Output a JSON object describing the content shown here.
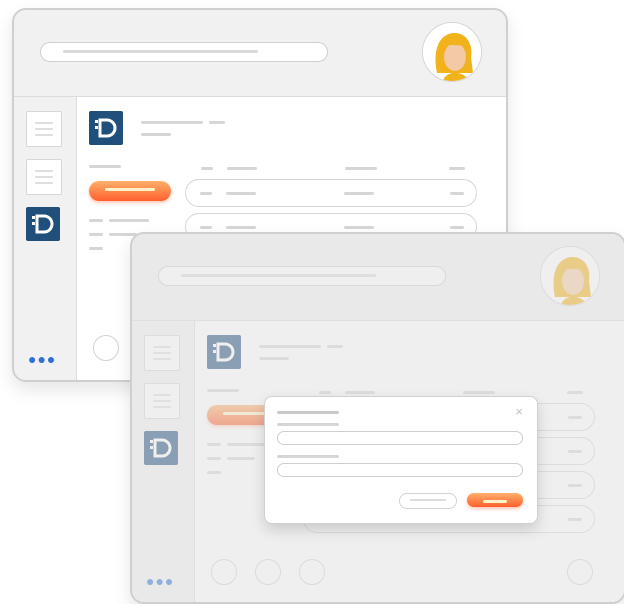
{
  "colors": {
    "brand_logo": "#1f4f7a",
    "primary_button_start": "#ffb06a",
    "primary_button_end": "#ff5f2e",
    "dots": "#2f6fd6"
  },
  "icons": {
    "avatar": "user-avatar-icon",
    "logo": "d-logo-icon",
    "more": "more-dots-icon",
    "close": "close-icon",
    "document": "document-icon"
  },
  "sidebar": {
    "more_label": "●●●"
  },
  "dialog": {
    "close_glyph": "×"
  }
}
